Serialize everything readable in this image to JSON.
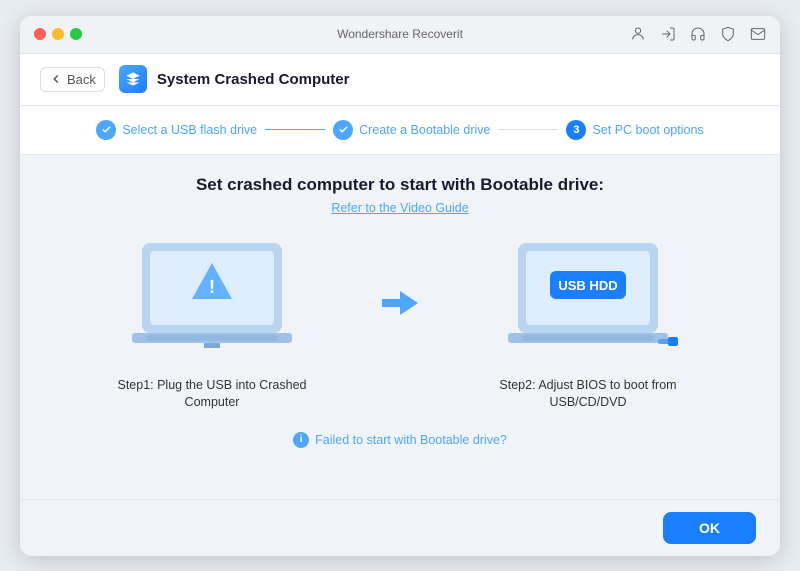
{
  "titlebar": {
    "title": "Wondershare Recoverit"
  },
  "header": {
    "back_label": "Back",
    "page_title": "System Crashed Computer"
  },
  "steps": [
    {
      "id": 1,
      "label": "Select a USB flash drive",
      "state": "done"
    },
    {
      "id": 2,
      "label": "Create a Bootable drive",
      "state": "done"
    },
    {
      "id": 3,
      "label": "Set PC boot options",
      "state": "active"
    }
  ],
  "main": {
    "title": "Set crashed computer to start with Bootable drive:",
    "video_link": "Refer to the Video Guide",
    "step1": {
      "label": "Step1:  Plug the USB into Crashed Computer"
    },
    "step2": {
      "label": "Step2:  Adjust BIOS to boot from USB/CD/DVD",
      "usb_badge": "USB HDD"
    },
    "failed_link": "Failed to start with Bootable drive?"
  },
  "footer": {
    "ok_label": "OK"
  },
  "colors": {
    "accent": "#1a7fff",
    "accent_light": "#4da6ff",
    "laptop_body": "#a8c8f0",
    "laptop_screen": "#cce0ff"
  }
}
